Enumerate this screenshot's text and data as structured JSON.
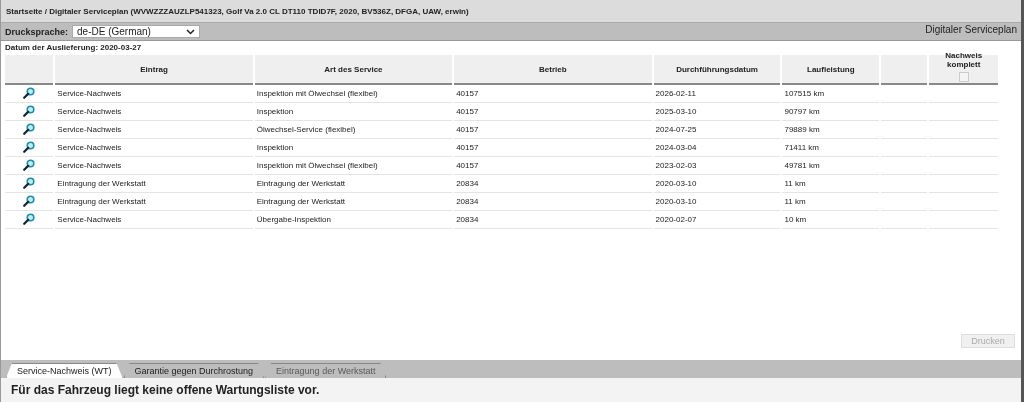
{
  "breadcrumb": "Startseite / Digitaler Serviceplan (WVWZZZAUZLP541323, Golf Va 2.0 CL DT110 TDID7F, 2020, BV536Z, DFGA, UAW, erwin)",
  "toolbar": {
    "label": "Drucksprache:",
    "select_value": "de-DE (German)",
    "title": "Digitaler Serviceplan"
  },
  "delivery_date": "Datum der Auslieferung: 2020-03-27",
  "table": {
    "columns": [
      "Eintrag",
      "Art des Service",
      "Betrieb",
      "Durchführungsdatum",
      "Laufleistung",
      "Nachweis komplett"
    ],
    "header_checkbox": {
      "checked": false,
      "disabled": true
    },
    "rows": [
      {
        "entry": "Service-Nachweis",
        "service": "Inspektion mit Ölwechsel (flexibel)",
        "workshop": "40157",
        "date": "2026-02-11",
        "mileage": "107515 km"
      },
      {
        "entry": "Service-Nachweis",
        "service": "Inspektion",
        "workshop": "40157",
        "date": "2025-03-10",
        "mileage": "90797 km"
      },
      {
        "entry": "Service-Nachweis",
        "service": "Ölwechsel-Service (flexibel)",
        "workshop": "40157",
        "date": "2024-07-25",
        "mileage": "79889 km"
      },
      {
        "entry": "Service-Nachweis",
        "service": "Inspektion",
        "workshop": "40157",
        "date": "2024-03-04",
        "mileage": "71411 km"
      },
      {
        "entry": "Service-Nachweis",
        "service": "Inspektion mit Ölwechsel (flexibel)",
        "workshop": "40157",
        "date": "2023-02-03",
        "mileage": "49781 km"
      },
      {
        "entry": "Eintragung der Werkstatt",
        "service": "Eintragung der Werkstatt",
        "workshop": "20834",
        "date": "2020-03-10",
        "mileage": "11 km"
      },
      {
        "entry": "Eintragung der Werkstatt",
        "service": "Eintragung der Werkstatt",
        "workshop": "20834",
        "date": "2020-03-10",
        "mileage": "11 km"
      },
      {
        "entry": "Service-Nachweis",
        "service": "Übergabe-Inspektion",
        "workshop": "20834",
        "date": "2020-02-07",
        "mileage": "10 km"
      }
    ]
  },
  "print_button": {
    "label": "Drucken",
    "disabled": true
  },
  "tabs": [
    {
      "label": "Service-Nachweis (WT)",
      "selected": true,
      "disabled": false
    },
    {
      "label": "Garantie gegen Durchrostung",
      "selected": false,
      "disabled": false
    },
    {
      "label": "Eintragung der Werkstatt",
      "selected": false,
      "disabled": true
    }
  ],
  "message": "Für das Fahrzeug liegt keine offene Wartungsliste vor."
}
